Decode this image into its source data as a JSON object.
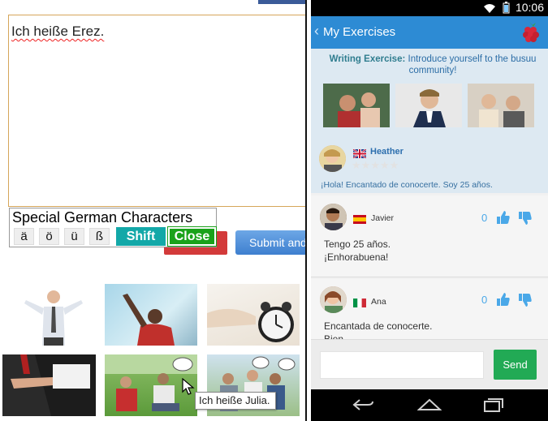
{
  "left_panel": {
    "editor_text": "Ich heiße Erez.",
    "keyboard": {
      "title": "Special German Characters",
      "keys": [
        "ä",
        "ö",
        "ü",
        "ß"
      ],
      "shift_label": "Shift",
      "close_label": "Close"
    },
    "submit_label": "Submit and",
    "tooltip": "Ich heiße Julia."
  },
  "phone": {
    "status_time": "10:06",
    "app_title": "My Exercises",
    "exercise": {
      "prompt_label": "Writing Exercise:",
      "prompt_text": "Introduce yourself to the busuu community!"
    },
    "author": {
      "name": "Heather",
      "text": "¡Hola! Encantado de conocerte. Soy 25 años."
    },
    "comments": [
      {
        "name": "Javier",
        "count": "0",
        "lines": [
          "Tengo 25 años.",
          "¡Enhorabuena!"
        ]
      },
      {
        "name": "Ana",
        "count": "0",
        "lines": [
          "Encantada de conocerte.",
          "Bien"
        ]
      }
    ],
    "send_label": "Send"
  },
  "colors": {
    "app_bar": "#2d8bd4",
    "send": "#22aa55",
    "shift": "#13a8a8",
    "close": "#1aa21a"
  }
}
